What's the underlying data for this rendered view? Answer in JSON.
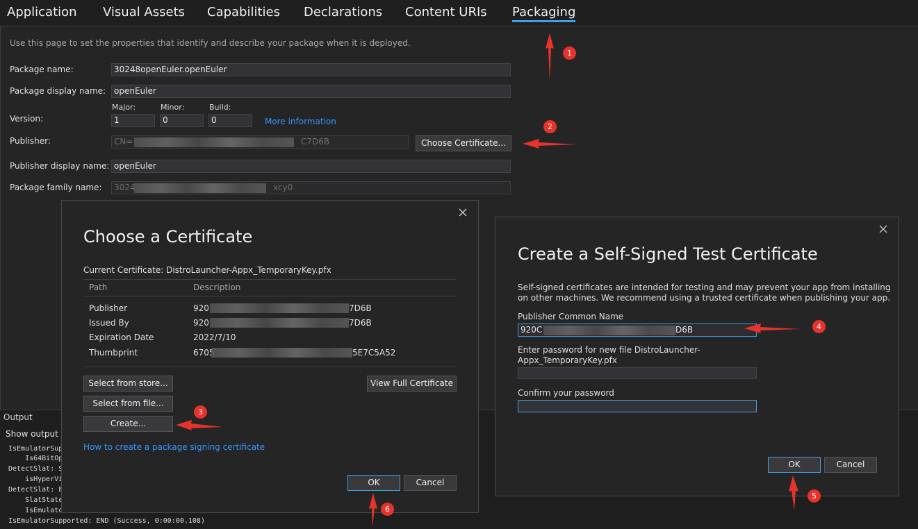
{
  "tabs": [
    {
      "label": "Application"
    },
    {
      "label": "Visual Assets"
    },
    {
      "label": "Capabilities"
    },
    {
      "label": "Declarations"
    },
    {
      "label": "Content URIs"
    },
    {
      "label": "Packaging"
    }
  ],
  "active_tab": "Packaging",
  "packaging": {
    "description": "Use this page to set the properties that identify and describe your package when it is deployed.",
    "package_name_label": "Package name:",
    "package_name_value": "30248openEuler.openEuler",
    "display_name_label": "Package display name:",
    "display_name_value": "openEuler",
    "version_label": "Version:",
    "major_label": "Major:",
    "minor_label": "Minor:",
    "build_label": "Build:",
    "major_value": "1",
    "minor_value": "0",
    "build_value": "0",
    "more_info_link": "More information",
    "publisher_label": "Publisher:",
    "publisher_prefix": "CN=",
    "publisher_suffix": "C7D6B",
    "choose_cert_button": "Choose Certificate...",
    "publisher_display_label": "Publisher display name:",
    "publisher_display_value": "openEuler",
    "family_name_label": "Package family name:",
    "family_prefix": "3024",
    "family_suffix": "xcy0"
  },
  "output": {
    "title": "Output",
    "show_output": "Show output f",
    "lines": [
      "IsEmulatorSup",
      "    Is64BitOp",
      "DetectSlat: S",
      "    isHyperVi",
      "DetectSlat: E",
      "    SlatState",
      "    IsEmulato",
      "IsEmulatorSupported: END (Success, 0:00:00.108)"
    ]
  },
  "choose_dialog": {
    "title": "Choose a Certificate",
    "current_cert": "Current Certificate: DistroLauncher-Appx_TemporaryKey.pfx",
    "col_path": "Path",
    "col_description": "Description",
    "rows": [
      {
        "key": "Publisher",
        "prefix": "920",
        "suffix": "7D6B"
      },
      {
        "key": "Issued By",
        "prefix": "920",
        "suffix": "7D6B"
      },
      {
        "key": "Expiration Date",
        "prefix": "2022/7/10",
        "suffix": ""
      },
      {
        "key": "Thumbprint",
        "prefix": "6705",
        "suffix": "5E7C5A52"
      }
    ],
    "select_store_button": "Select from store...",
    "select_file_button": "Select from file...",
    "create_button": "Create...",
    "view_full_button": "View Full Certificate",
    "howto_link": "How to create a package signing certificate",
    "ok_button": "OK",
    "cancel_button": "Cancel"
  },
  "self_signed_dialog": {
    "title": "Create a Self-Signed Test Certificate",
    "warning_line1": "Self-signed certificates are intended for testing and may prevent your app from installing",
    "warning_line2": "on other machines. We recommend using a trusted certificate when publishing your app.",
    "common_name_label": "Publisher Common Name",
    "common_name_prefix": "920C",
    "common_name_suffix": "D6B",
    "password_label_line1": "Enter password for new file DistroLauncher-",
    "password_label_line2": "Appx_TemporaryKey.pfx",
    "password_value": "",
    "confirm_label": "Confirm your password",
    "confirm_value": "",
    "ok_button": "OK",
    "cancel_button": "Cancel"
  },
  "annotations": [
    "1",
    "2",
    "3",
    "4",
    "5",
    "6"
  ],
  "colors": {
    "annotation": "#e8322c",
    "accent": "#3f9fe8",
    "link": "#3794ff"
  }
}
